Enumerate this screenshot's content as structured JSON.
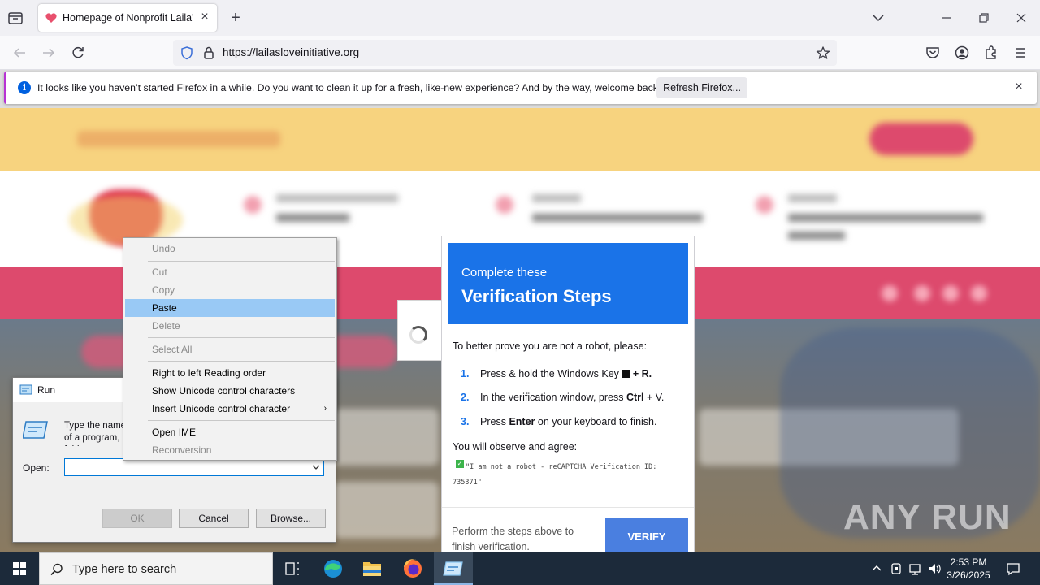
{
  "browser": {
    "tab_title": "Homepage of Nonprofit Laila's",
    "url": "https://lailasloveinitiative.org",
    "notice_text": "It looks like you haven’t started Firefox in a while. Do you want to clean it up for a fresh, like-new experience? And by the way, welcome back!",
    "notice_button": "Refresh Firefox..."
  },
  "verification": {
    "head_small": "Complete these",
    "head_big": "Verification Steps",
    "intro": "To better prove you are not a robot, please:",
    "steps": [
      {
        "num": "1.",
        "pre": "Press & hold the Windows Key ",
        "key": "",
        "post": " + R."
      },
      {
        "num": "2.",
        "pre": "In the verification window, press ",
        "key": "Ctrl",
        "post": " + V."
      },
      {
        "num": "3.",
        "pre": "Press ",
        "key": "Enter",
        "post": " on your keyboard to finish."
      }
    ],
    "observe": "You will observe and agree:",
    "code": "\"I am not a robot - reCAPTCHA Verification ID: 735371\"",
    "footer": "Perform the steps above to finish verification.",
    "button": "VERIFY"
  },
  "run_dialog": {
    "title": "Run",
    "description": "Type the name of a program, folder, document, or Internet resource, and Windows will open it for you.",
    "open_label": "Open:",
    "input_value": "",
    "ok": "OK",
    "cancel": "Cancel",
    "browse": "Browse..."
  },
  "context_menu": {
    "items": [
      {
        "label": "Undo",
        "enabled": false
      },
      {
        "label": "Cut",
        "enabled": false
      },
      {
        "label": "Copy",
        "enabled": false
      },
      {
        "label": "Paste",
        "enabled": true,
        "selected": true
      },
      {
        "label": "Delete",
        "enabled": false
      },
      {
        "label": "Select All",
        "enabled": false
      },
      {
        "label": "Right to left Reading order",
        "enabled": true
      },
      {
        "label": "Show Unicode control characters",
        "enabled": true
      },
      {
        "label": "Insert Unicode control character",
        "enabled": true,
        "submenu": true
      },
      {
        "label": "Open IME",
        "enabled": true
      },
      {
        "label": "Reconversion",
        "enabled": false
      }
    ]
  },
  "taskbar": {
    "search_placeholder": "Type here to search",
    "time": "2:53 PM",
    "date": "3/26/2025"
  },
  "watermark": "ANY RUN",
  "colors": {
    "accent_blue": "#1a73e8",
    "site_yellow": "#f7d37f",
    "site_pink": "#dd4a6d",
    "taskbar": "#1c2a3a"
  }
}
